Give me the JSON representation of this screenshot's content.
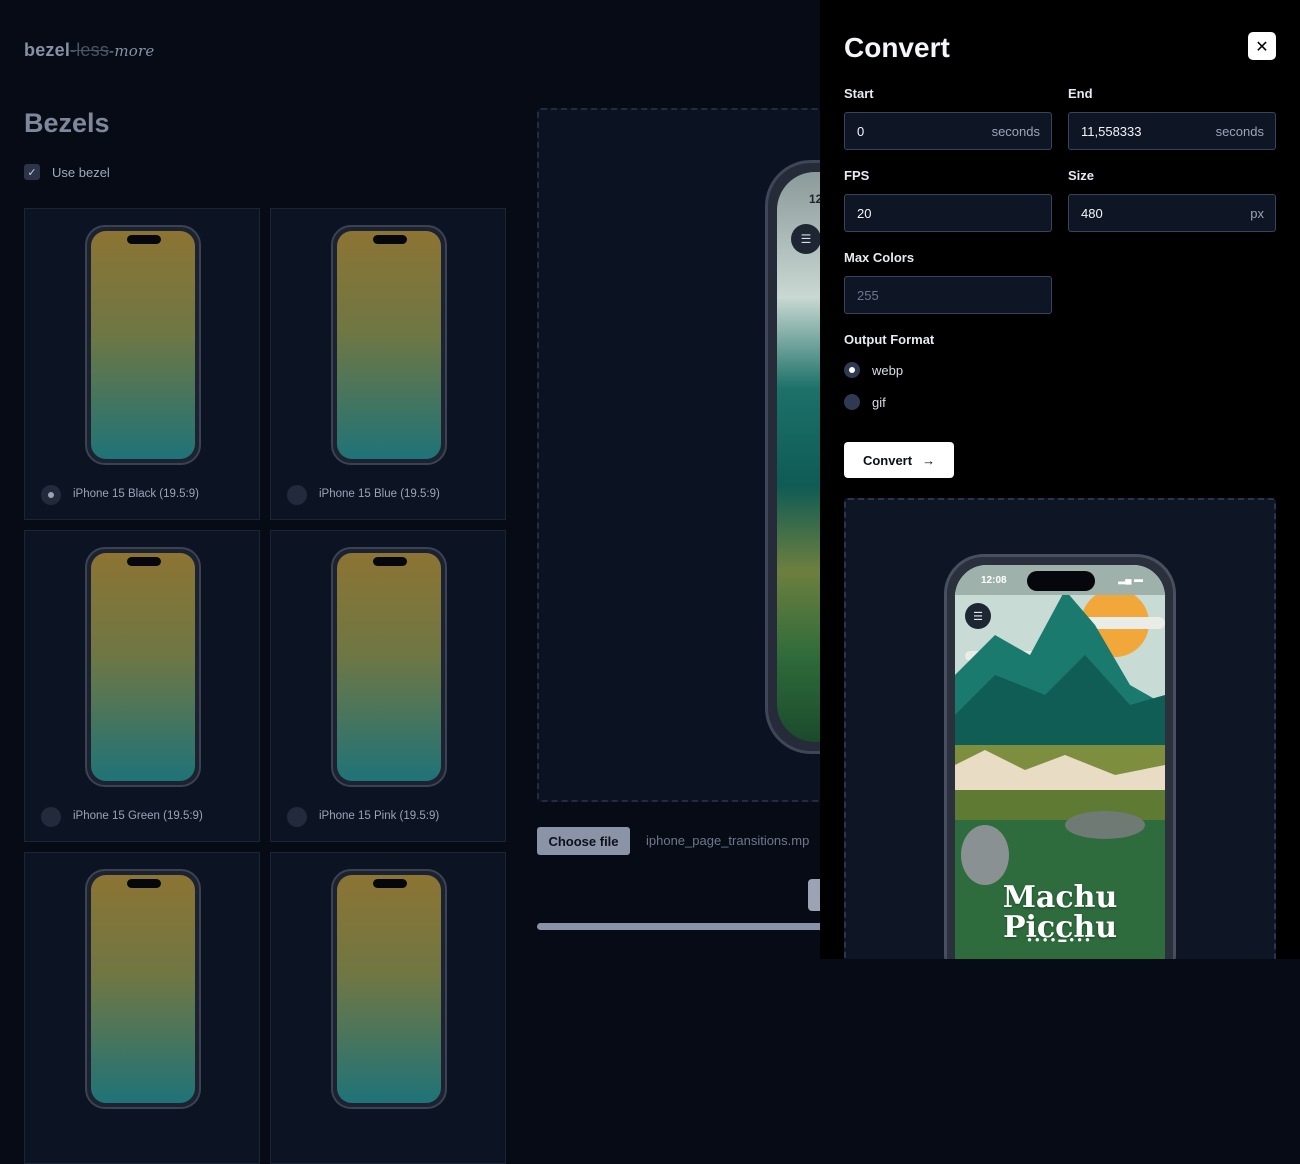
{
  "app": {
    "logo_a": "bezel",
    "logo_b": "-less",
    "logo_c": "-more"
  },
  "bezels": {
    "heading": "Bezels",
    "use_bezel_label": "Use bezel",
    "use_bezel_checked": true,
    "items": [
      {
        "label": "iPhone 15 Black (19.5:9)",
        "selected": true
      },
      {
        "label": "iPhone 15 Blue (19.5:9)",
        "selected": false
      },
      {
        "label": "iPhone 15 Green (19.5:9)",
        "selected": false
      },
      {
        "label": "iPhone 15 Pink (19.5:9)",
        "selected": false
      },
      {
        "label": "",
        "selected": false
      },
      {
        "label": "",
        "selected": false
      }
    ]
  },
  "upload": {
    "preview_time": "12",
    "choose_label": "Choose file",
    "file_name": "iphone_page_transitions.mp"
  },
  "convert": {
    "title": "Convert",
    "start_label": "Start",
    "start_value": "0",
    "start_unit": "seconds",
    "end_label": "End",
    "end_value": "11,558333",
    "end_unit": "seconds",
    "fps_label": "FPS",
    "fps_value": "20",
    "size_label": "Size",
    "size_value": "480",
    "size_unit": "px",
    "max_colors_label": "Max Colors",
    "max_colors_placeholder": "255",
    "output_format_label": "Output Format",
    "formats": [
      {
        "label": "webp",
        "selected": true
      },
      {
        "label": "gif",
        "selected": false
      }
    ],
    "convert_button": "Convert",
    "convert_icon": "arrow-right-icon",
    "close_icon": "close-icon"
  },
  "preview": {
    "time": "12:08",
    "title_line1": "Machu",
    "title_line2": "Picchu"
  },
  "colors": {
    "background": "#070b16",
    "panel": "#000000",
    "accent": "#ffffff"
  }
}
